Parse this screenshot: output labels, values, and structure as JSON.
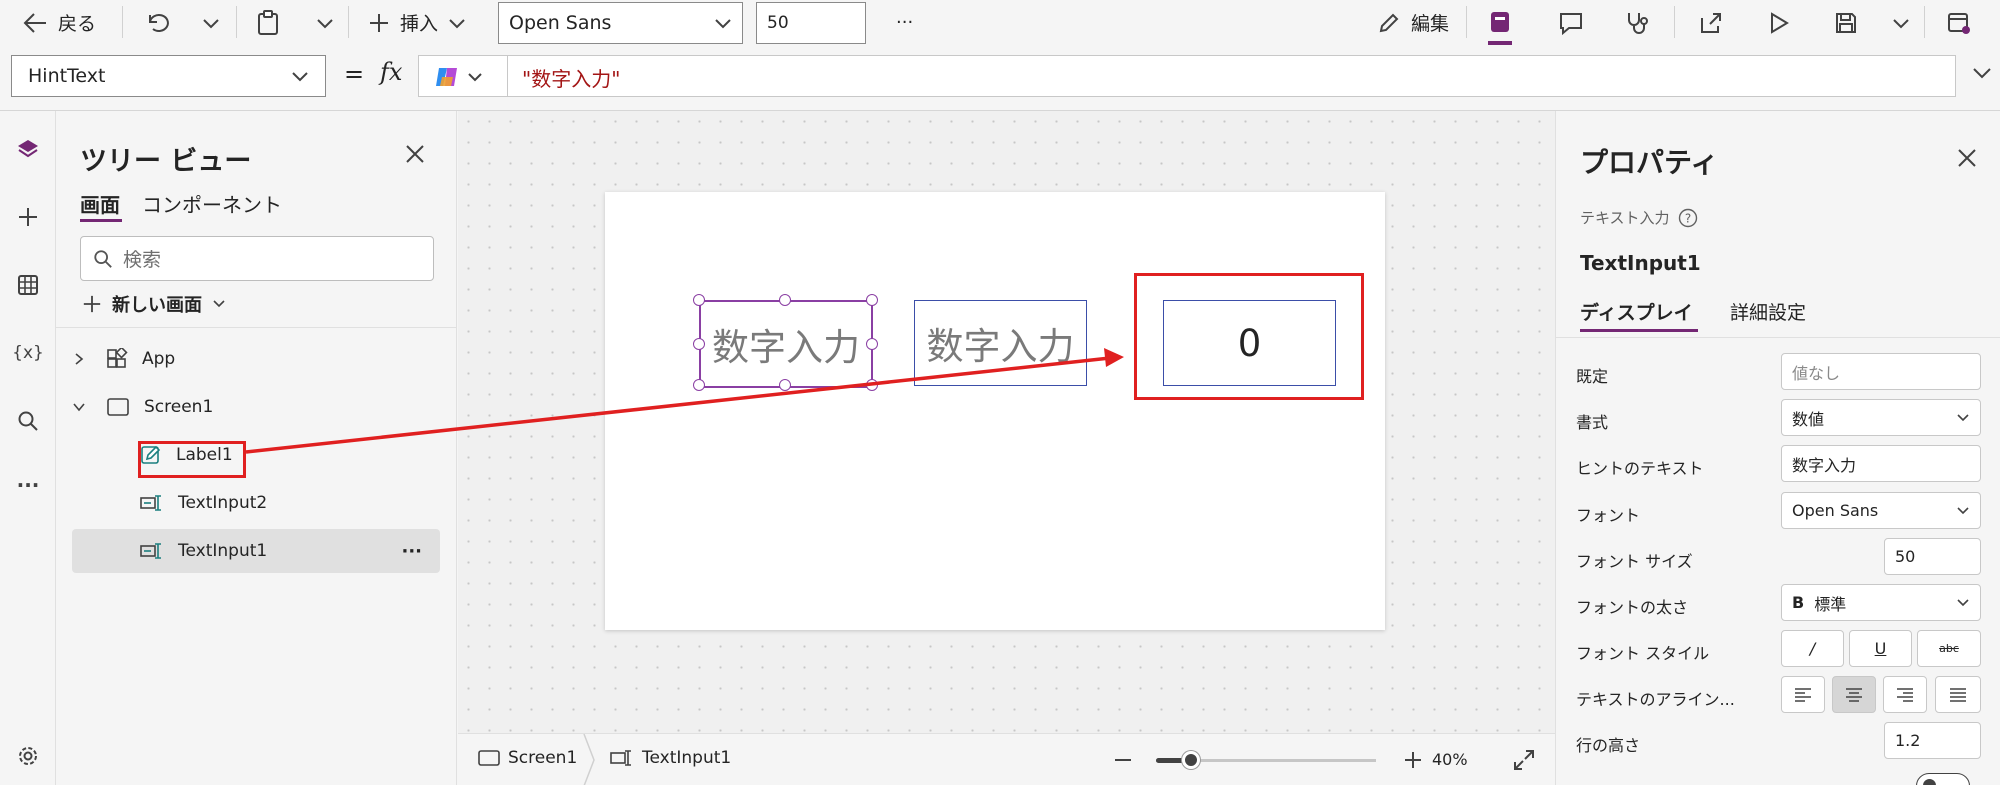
{
  "toolbar": {
    "back_label": "戻る",
    "insert_label": "挿入",
    "font_value": "Open Sans",
    "font_size_value": "50",
    "more_label": "···",
    "edit_label": "編集"
  },
  "formula_bar": {
    "property": "HintText",
    "equals": "=",
    "fx": "fx",
    "formula": "\"数字入力\""
  },
  "tree_view": {
    "title": "ツリー ビュー",
    "tabs": [
      "画面",
      "コンポーネント"
    ],
    "search_placeholder": "検索",
    "new_screen": "新しい画面",
    "items": [
      "App",
      "Screen1",
      "Label1",
      "TextInput2",
      "TextInput1"
    ],
    "item_more": "···"
  },
  "canvas": {
    "label1_text": "数字入力",
    "textinput2_hint": "数字入力",
    "textinput1_value": "0"
  },
  "status_bar": {
    "screen": "Screen1",
    "control": "TextInput1",
    "zoom_level": 40,
    "zoom": "40%"
  },
  "properties": {
    "title": "プロパティ",
    "control_type": "テキスト入力",
    "control_name": "TextInput1",
    "tabs": [
      "ディスプレイ",
      "詳細設定"
    ],
    "rows": {
      "default": {
        "label": "既定",
        "placeholder": "値なし"
      },
      "format": {
        "label": "書式",
        "value": "数値"
      },
      "hint": {
        "label": "ヒントのテキスト",
        "value": "数字入力"
      },
      "font": {
        "label": "フォント",
        "value": "Open Sans"
      },
      "font_size": {
        "label": "フォント サイズ",
        "value": "50"
      },
      "font_weight": {
        "label": "フォントの太さ",
        "icon": "B",
        "value": "標準"
      },
      "font_style": {
        "label": "フォント スタイル",
        "italic": "/",
        "underline": "U",
        "strike": "abc"
      },
      "align": {
        "label": "テキストのアライン..."
      },
      "line_height": {
        "label": "行の高さ",
        "value": "1.2"
      }
    }
  },
  "colors": {
    "accent": "#742774",
    "highlight_red": "#e02020",
    "selection": "#8a3fa3"
  }
}
